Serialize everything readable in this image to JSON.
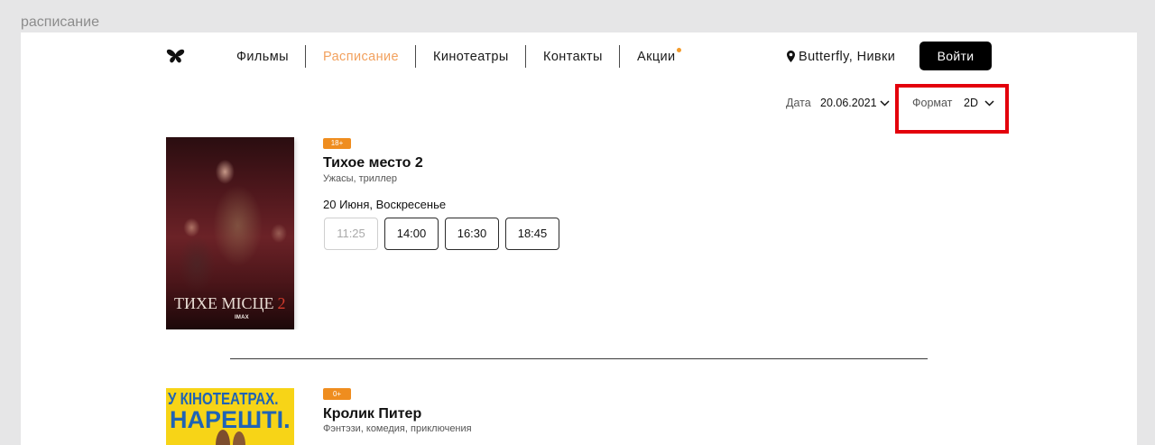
{
  "page_label": "расписание",
  "colors": {
    "accent": "#f2a15e",
    "dot": "#f39a2a",
    "badge": "#ef8d1f",
    "button": "#000000",
    "highlight": "#e3000b",
    "poster_blue": "#1f63b5"
  },
  "header": {
    "logo_icon": "butterfly-icon",
    "nav": [
      {
        "label": "Фильмы",
        "active": false,
        "has_dot": false
      },
      {
        "label": "Расписание",
        "active": true,
        "has_dot": false
      },
      {
        "label": "Кинотеатры",
        "active": false,
        "has_dot": false
      },
      {
        "label": "Контакты",
        "active": false,
        "has_dot": false
      },
      {
        "label": "Акции",
        "active": false,
        "has_dot": true
      }
    ],
    "location": {
      "icon": "map-pin-icon",
      "label": "Butterfly, Нивки"
    },
    "login_label": "Войти"
  },
  "filters": {
    "date": {
      "label": "Дата",
      "value": "20.06.2021",
      "icon": "chevron-down-icon"
    },
    "format": {
      "label": "Формат",
      "value": "2D",
      "icon": "chevron-down-icon",
      "highlighted": true
    }
  },
  "movies": [
    {
      "age_rating": "18+",
      "title": "Тихое место 2",
      "genres": "Ужасы, триллер",
      "date": "20 Июня, Воскресенье",
      "poster": {
        "title": "ТИХЕ МІСЦЕ",
        "number": "2",
        "format_mark": "IMAX"
      },
      "sessions": [
        {
          "time": "11:25",
          "disabled": true
        },
        {
          "time": "14:00",
          "disabled": false
        },
        {
          "time": "16:30",
          "disabled": false
        },
        {
          "time": "18:45",
          "disabled": false
        }
      ]
    },
    {
      "age_rating": "0+",
      "title": "Кролик Питер",
      "genres": "Фэнтэзи, комедия, приключения",
      "poster": {
        "line1": "У КІНОТЕАТРАХ.",
        "line2": "НАРЕШТІ."
      }
    }
  ]
}
